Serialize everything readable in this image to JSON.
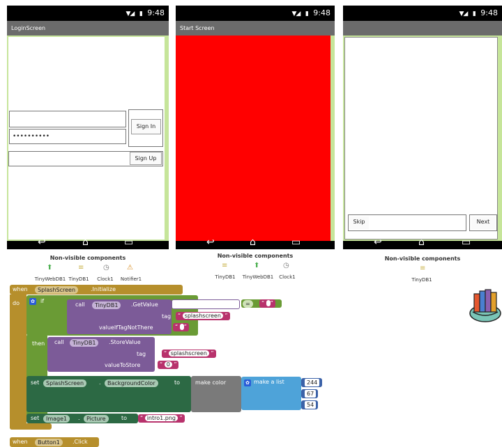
{
  "status_time": "9:48",
  "phones": [
    {
      "title": "LoginScreen",
      "password_value": "••••••••••",
      "signin_label": "Sign In",
      "signup_label": "Sign Up",
      "nonvisible_title": "Non-visible components",
      "components": [
        "TinyWebDB1",
        "TinyDB1",
        "Clock1",
        "Notifier1"
      ]
    },
    {
      "title": "Start Screen",
      "background_color": "#ff0000",
      "nonvisible_title": "Non-visible components",
      "components": [
        "TinyDB1",
        "TinyWebDB1",
        "Clock1"
      ]
    },
    {
      "title": "",
      "skip_label": "Skip",
      "next_label": "Next",
      "nonvisible_title": "Non-visible components",
      "components": [
        "TinyDB1"
      ]
    }
  ],
  "blocks": {
    "when": "when",
    "initialize_component": "SplashScreen",
    "initialize_event": ".Initialize",
    "do": "do",
    "if": "if",
    "then": "then",
    "call": "call",
    "getvalue_component": "TinyDB1",
    "getvalue_method": ".GetValue",
    "tag_label": "tag",
    "tag_value": "splashscreen",
    "value_if_tag_not_there": "valueIfTagNotThere",
    "empty_string": " ",
    "equals_op": "=",
    "storevalue_component": "TinyDB1",
    "storevalue_method": ".StoreValue",
    "tag_value_2": "splashscreen",
    "value_to_store_label": "valueToStore",
    "value_to_store": "0",
    "set": "set",
    "bg_component": "SplashScreen",
    "bg_property": "BackgroundColor",
    "to": "to",
    "make_color": "make color",
    "make_a_list": "make a list",
    "rgb": [
      "244",
      "67",
      "54"
    ],
    "image_component": "Image1",
    "image_property": "Picture",
    "image_value": "intro1.png",
    "click_component": "Button1",
    "click_event": ".Click"
  },
  "colors": {
    "event_block": "#b68f2c",
    "control_block": "#6a9b35",
    "procedure_block": "#7c5b98",
    "set_block": "#2c6944",
    "color_block": "#7a7a7a",
    "list_block": "#4ea3d9",
    "text_block": "#b8326c",
    "number_block": "#3c62a8"
  }
}
